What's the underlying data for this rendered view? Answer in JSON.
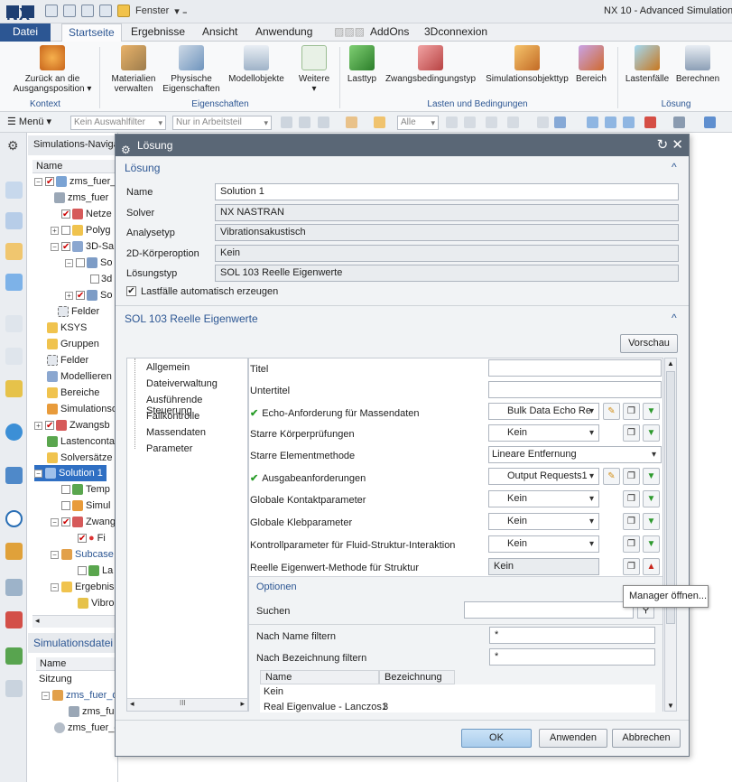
{
  "app": {
    "logo": "NX",
    "window_menu": "Fenster",
    "title": "NX 10 - Advanced Simulation -"
  },
  "tabs": [
    "Datei",
    "Startseite",
    "Ergebnisse",
    "Ansicht",
    "Anwendung",
    "AddOns",
    "3Dconnexion"
  ],
  "ribbon": {
    "kontext": {
      "btn1": "Zurück an die",
      "btn1b": "Ausgangsposition ▾",
      "group": "Kontext"
    },
    "eigenschaften": {
      "b1": "Materialien",
      "b1b": "verwalten",
      "b2": "Physische",
      "b2b": "Eigenschaften",
      "b3": "Modellobjekte",
      "b4": "Weitere",
      "group": "Eigenschaften"
    },
    "lasten": {
      "b1": "Lasttyp",
      "b2": "Zwangsbedingungstyp",
      "b3": "Simulationsobjekttyp",
      "b4": "Bereich",
      "group": "Lasten und Bedingungen"
    },
    "loesung": {
      "b1": "Lastenfälle",
      "b2": "Berechnen",
      "group": "Lösung"
    }
  },
  "toolbar": {
    "menu": "Menü ▾",
    "filter": "Kein Auswahlfilter",
    "scope": "Nur in Arbeitsteil",
    "alle": "Alle"
  },
  "navigator": {
    "title": "Simulations-Navigator",
    "col": "Name",
    "items": [
      "zms_fuer_d",
      "zms_fuer",
      "Netze",
      "Polyg",
      "3D-Sa",
      "So",
      "3d",
      "So",
      "Felder",
      "KSYS",
      "Gruppen",
      "Felder",
      "Modellieren",
      "Bereiche",
      "Simulationso",
      "Zwangsb",
      "Lastencontai",
      "Solversätze",
      "Solution 1",
      "Temp",
      "Simul",
      "Zwang",
      "Fi",
      "Subcase",
      "La",
      "Ergebnis",
      "Vibro"
    ],
    "sim_title": "Simulationsdatei",
    "sim_col": "Name",
    "sim_items": [
      "Sitzung",
      "zms_fuer_d",
      "zms_fue",
      "zms_fuer_d"
    ]
  },
  "dialog": {
    "title": "Lösung",
    "sec1": "Lösung",
    "name_label": "Name",
    "name_value": "Solution 1",
    "solver_label": "Solver",
    "solver_value": "NX NASTRAN",
    "analysetyp_label": "Analysetyp",
    "analysetyp_value": "Vibrationsakustisch",
    "k2d_label": "2D-Körperoption",
    "k2d_value": "Kein",
    "loesungstyp_label": "Lösungstyp",
    "loesungstyp_value": "SOL 103 Reelle Eigenwerte",
    "auto_label": "Lastfälle automatisch erzeugen",
    "sec2": "SOL 103 Reelle Eigenwerte",
    "vorschau": "Vorschau",
    "tree": [
      "Allgemein",
      "Dateiverwaltung",
      "Ausführende Steuerung",
      "Fallkontrolle",
      "Massendaten",
      "Parameter"
    ],
    "params": [
      {
        "label": "Titel",
        "value": ""
      },
      {
        "label": "Untertitel",
        "value": ""
      },
      {
        "label": "Echo-Anforderung für Massendaten",
        "value": "Bulk Data Echo Re"
      },
      {
        "label": "Starre Körperprüfungen",
        "value": "Kein"
      },
      {
        "label": "Starre Elementmethode",
        "value": "Lineare Entfernung"
      },
      {
        "label": "Ausgabeanforderungen",
        "value": "Output Requests1"
      },
      {
        "label": "Globale Kontaktparameter",
        "value": "Kein"
      },
      {
        "label": "Globale Klebparameter",
        "value": "Kein"
      },
      {
        "label": "Kontrollparameter für Fluid-Struktur-Interaktion",
        "value": "Kein"
      },
      {
        "label": "Reelle Eigenwert-Methode für Struktur",
        "value": "Kein"
      }
    ],
    "optionen": "Optionen",
    "suchen": "Suchen",
    "name_filter": "Nach Name filtern",
    "name_filter_value": "*",
    "bez_filter": "Nach Bezeichnung filtern",
    "bez_filter_value": "*",
    "table": {
      "col1": "Name",
      "col2": "Bezeichnung",
      "rows": [
        {
          "name": "Kein",
          "bez": ""
        },
        {
          "name": "Real Eigenvalue - Lanczos1",
          "bez": "3"
        }
      ]
    },
    "ok": "OK",
    "apply": "Anwenden",
    "cancel": "Abbrechen",
    "tooltip": "Manager öffnen..."
  },
  "scroll_glyph": "III"
}
